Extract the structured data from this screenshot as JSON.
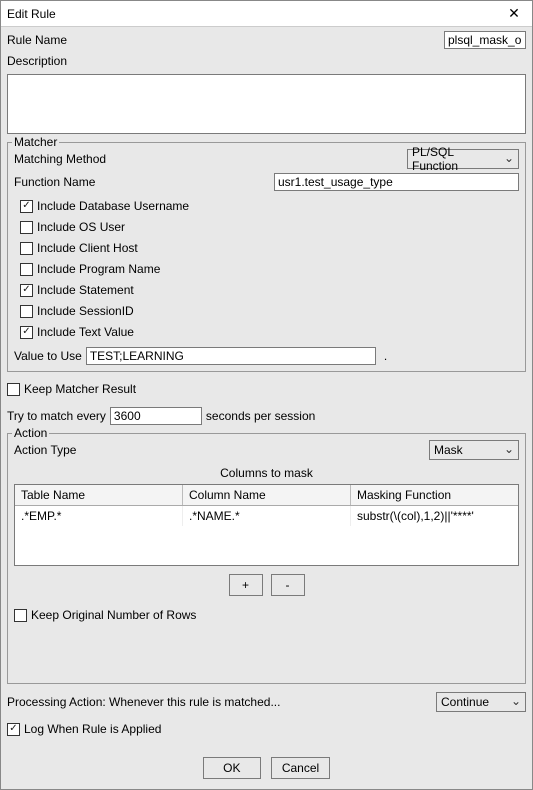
{
  "title": "Edit Rule",
  "ruleName": {
    "label": "Rule Name",
    "value": "plsql_mask_ora"
  },
  "description": {
    "label": "Description",
    "value": ""
  },
  "matcher": {
    "group": "Matcher",
    "method": {
      "label": "Matching Method",
      "value": "PL/SQL Function"
    },
    "funcName": {
      "label": "Function Name",
      "value": "usr1.test_usage_type"
    },
    "checks": {
      "dbUser": {
        "label": "Include Database Username",
        "checked": true
      },
      "osUser": {
        "label": "Include OS User",
        "checked": false
      },
      "host": {
        "label": "Include Client Host",
        "checked": false
      },
      "program": {
        "label": "Include Program Name",
        "checked": false
      },
      "stmt": {
        "label": "Include Statement",
        "checked": true
      },
      "sess": {
        "label": "Include SessionID",
        "checked": false
      },
      "text": {
        "label": "Include Text Value",
        "checked": true
      }
    },
    "valueToUse": {
      "label": "Value to Use",
      "value": "TEST;LEARNING",
      "suffix": "."
    }
  },
  "keepResult": {
    "label": "Keep Matcher Result",
    "checked": false
  },
  "tryMatch": {
    "prefix": "Try to match every",
    "value": "3600",
    "suffix": "seconds per session"
  },
  "action": {
    "group": "Action",
    "type": {
      "label": "Action Type",
      "value": "Mask"
    },
    "colsHeader": "Columns to mask",
    "table": {
      "headers": [
        "Table Name",
        "Column Name",
        "Masking Function"
      ],
      "rows": [
        {
          "table": ".*EMP.*",
          "column": ".*NAME.*",
          "func": "substr(\\(col),1,2)||'****'"
        }
      ]
    },
    "addBtn": "+",
    "delBtn": "-",
    "keepRows": {
      "label": "Keep Original Number of Rows",
      "checked": false
    }
  },
  "procAction": {
    "label": "Processing Action: Whenever this rule is matched...",
    "value": "Continue"
  },
  "logApplied": {
    "label": "Log When Rule is Applied",
    "checked": true
  },
  "buttons": {
    "ok": "OK",
    "cancel": "Cancel"
  }
}
